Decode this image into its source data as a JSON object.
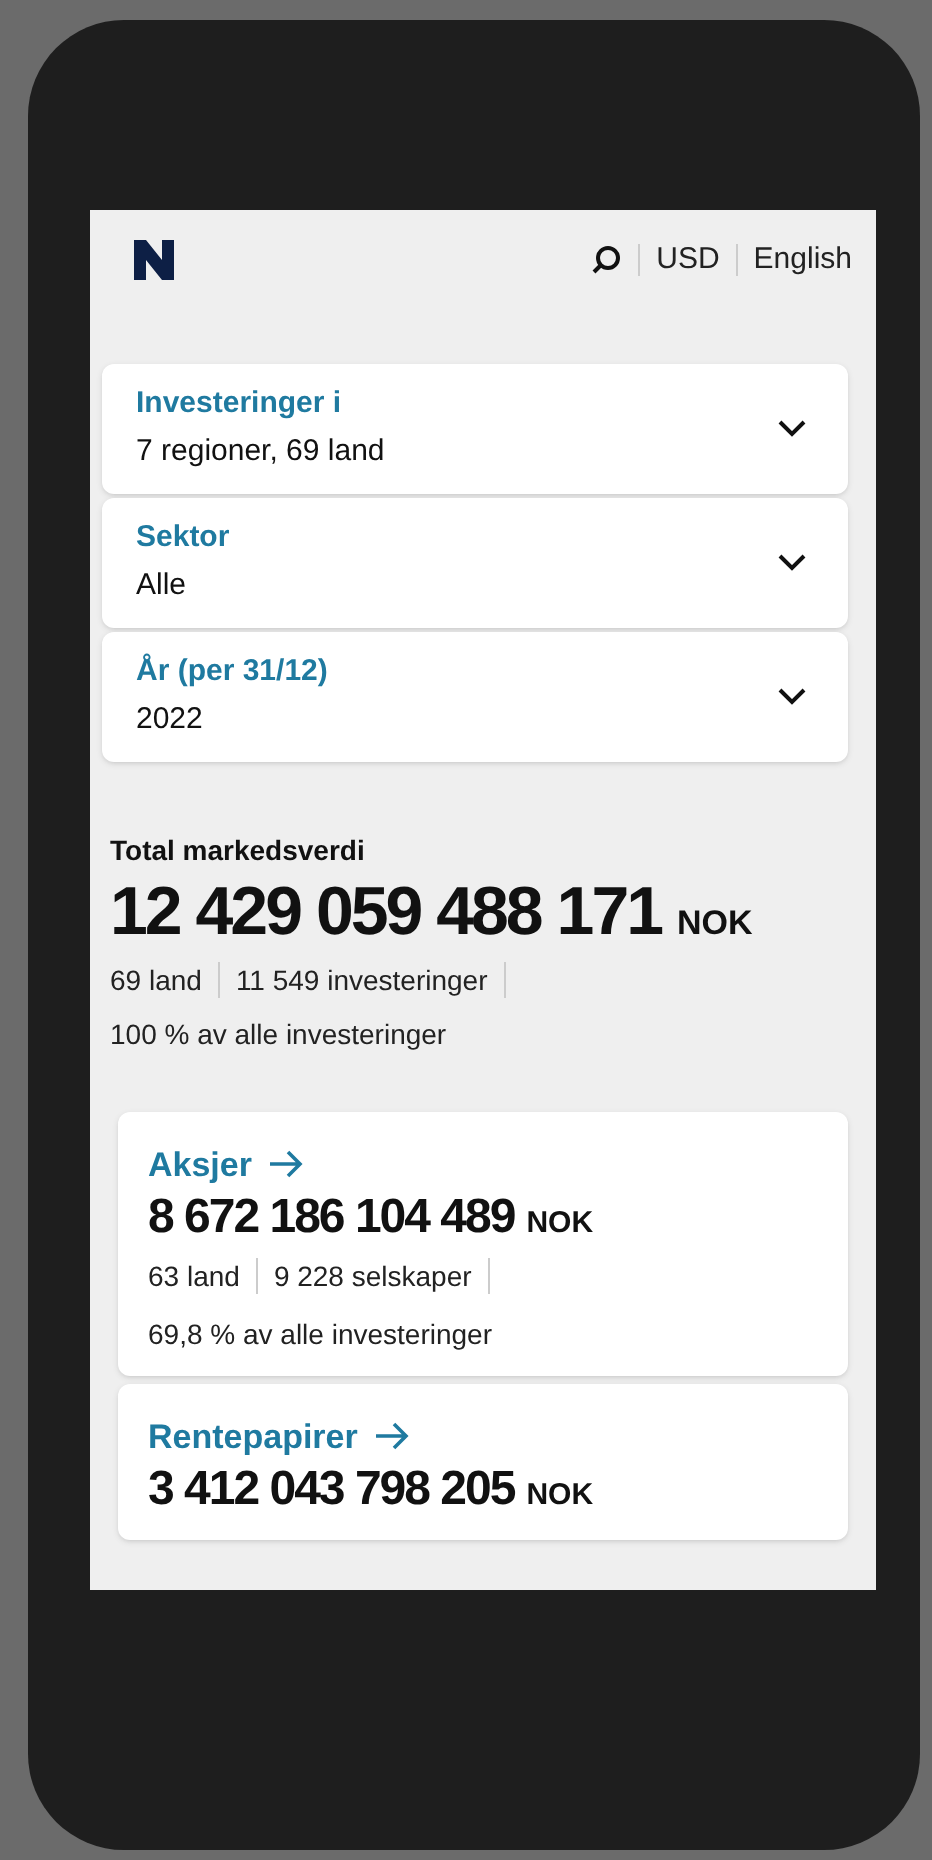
{
  "header": {
    "currency": "USD",
    "language": "English"
  },
  "filters": [
    {
      "label": "Investeringer i",
      "value": "7 regioner, 69 land"
    },
    {
      "label": "Sektor",
      "value": "Alle"
    },
    {
      "label": "År (per 31/12)",
      "value": "2022"
    }
  ],
  "summary": {
    "title": "Total markedsverdi",
    "amount": "12 429 059 488 171",
    "currency": "NOK",
    "stats": [
      "69 land",
      "11 549 investeringer"
    ],
    "share": "100 % av alle investeringer"
  },
  "cards": [
    {
      "title": "Aksjer",
      "amount": "8 672 186 104 489",
      "currency": "NOK",
      "stats": [
        "63 land",
        "9 228 selskaper"
      ],
      "share": "69,8 % av alle investeringer"
    },
    {
      "title": "Rentepapirer",
      "amount": "3 412 043 798 205",
      "currency": "NOK"
    }
  ]
}
